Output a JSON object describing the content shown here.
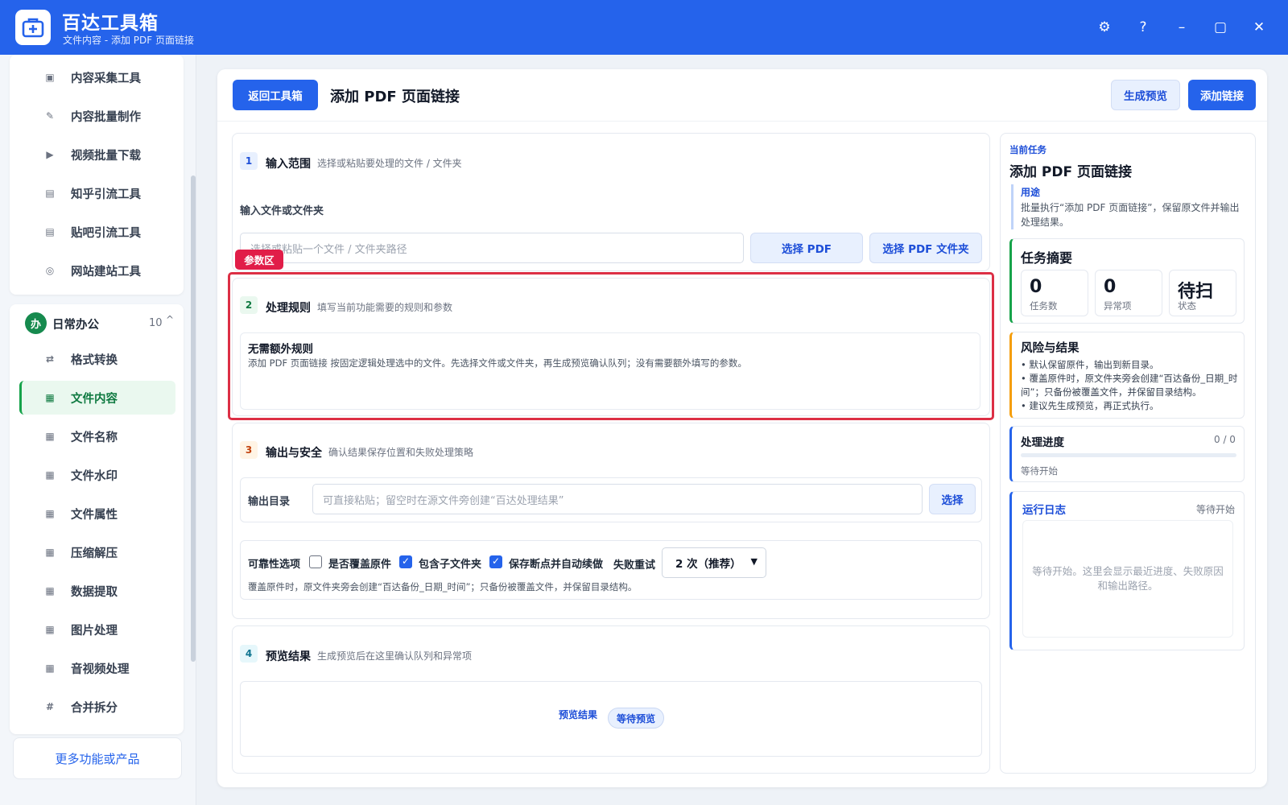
{
  "app": {
    "name": "百达工具箱",
    "subtitle": "文件内容 - 添加 PDF 页面链接"
  },
  "window_controls": {
    "settings": "⚙",
    "help": "?",
    "minimize": "–",
    "maximize": "▢",
    "close": "✕"
  },
  "sidebar": {
    "top_items": [
      {
        "label": "内容采集工具",
        "icon": "▣"
      },
      {
        "label": "内容批量制作",
        "icon": "✎"
      },
      {
        "label": "视频批量下载",
        "icon": "▶"
      },
      {
        "label": "知乎引流工具",
        "icon": "▤"
      },
      {
        "label": "贴吧引流工具",
        "icon": "▤"
      },
      {
        "label": "网站建站工具",
        "icon": "◎"
      }
    ],
    "group": {
      "badge": "办",
      "title": "日常办公",
      "count": "10",
      "caret": "^"
    },
    "group_items": [
      {
        "label": "格式转换",
        "icon": "⇄"
      },
      {
        "label": "文件内容",
        "icon": "▦"
      },
      {
        "label": "文件名称",
        "icon": "▦"
      },
      {
        "label": "文件水印",
        "icon": "▦"
      },
      {
        "label": "文件属性",
        "icon": "▦"
      },
      {
        "label": "压缩解压",
        "icon": "▦"
      },
      {
        "label": "数据提取",
        "icon": "▦"
      },
      {
        "label": "图片处理",
        "icon": "▦"
      },
      {
        "label": "音视频处理",
        "icon": "▦"
      },
      {
        "label": "合并拆分",
        "icon": "#"
      }
    ],
    "active": "文件内容",
    "more_button": "更多功能或产品"
  },
  "header": {
    "back_button": "返回工具箱",
    "title": "添加 PDF 页面链接",
    "preview_button": "生成预览",
    "add_button": "添加链接"
  },
  "section1": {
    "num": "1",
    "title": "输入范围",
    "desc": "选择或粘贴要处理的文件 / 文件夹",
    "field_label": "输入文件或文件夹",
    "input_placeholder": "选择或粘贴一个文件 / 文件夹路径",
    "select_pdf": "选择 PDF",
    "select_folder": "选择 PDF 文件夹"
  },
  "param_tag": "参数区",
  "section2": {
    "num": "2",
    "title": "处理规则",
    "desc": "填写当前功能需要的规则和参数",
    "rule_title": "无需额外规则",
    "rule_desc": "添加 PDF 页面链接 按固定逻辑处理选中的文件。先选择文件或文件夹，再生成预览确认队列；没有需要额外填写的参数。"
  },
  "section3": {
    "num": "3",
    "title": "输出与安全",
    "desc": "确认结果保存位置和失败处理策略",
    "output_label": "输出目录",
    "output_placeholder": "可直接粘贴；留空时在源文件旁创建“百达处理结果”",
    "output_select": "选择",
    "reliability_label": "可靠性选项",
    "options": [
      {
        "label": "是否覆盖原件",
        "checked": false
      },
      {
        "label": "包含子文件夹",
        "checked": true
      },
      {
        "label": "保存断点并自动续做",
        "checked": true
      }
    ],
    "retry_label": "失败重试",
    "retry_value": "2 次（推荐）",
    "note": "覆盖原件时，原文件夹旁会创建“百达备份_日期_时间”；只备份被覆盖文件，并保留目录结构。"
  },
  "section4": {
    "num": "4",
    "title": "预览结果",
    "desc": "生成预览后在这里确认队列和异常项",
    "label": "预览结果",
    "badge": "等待预览"
  },
  "right_panel": {
    "current_label": "当前任务",
    "task_title": "添加 PDF 页面链接",
    "usage_label": "用途",
    "usage_text": "批量执行“添加 PDF 页面链接”，保留原文件并输出处理结果。",
    "summary_title": "任务摘要",
    "stats": [
      {
        "value": "0",
        "label": "任务数"
      },
      {
        "value": "0",
        "label": "异常项"
      },
      {
        "value": "待扫",
        "label": "状态"
      }
    ],
    "risk_title": "风险与结果",
    "risk_items": [
      "默认保留原件，输出到新目录。",
      "覆盖原件时，原文件夹旁会创建“百达备份_日期_时间”；只备份被覆盖文件，并保留目录结构。",
      "建议先生成预览，再正式执行。"
    ],
    "progress_title": "处理进度",
    "progress_count": "0 / 0",
    "progress_fraction": 0,
    "progress_status": "等待开始",
    "log_title": "运行日志",
    "log_status": "等待开始",
    "log_placeholder": "等待开始。这里会显示最近进度、失败原因和输出路径。"
  },
  "colors": {
    "brand": "#2563eb",
    "active_green": "#16a34a",
    "highlight_red": "#dc2f45",
    "risk_orange": "#f59e0b"
  }
}
